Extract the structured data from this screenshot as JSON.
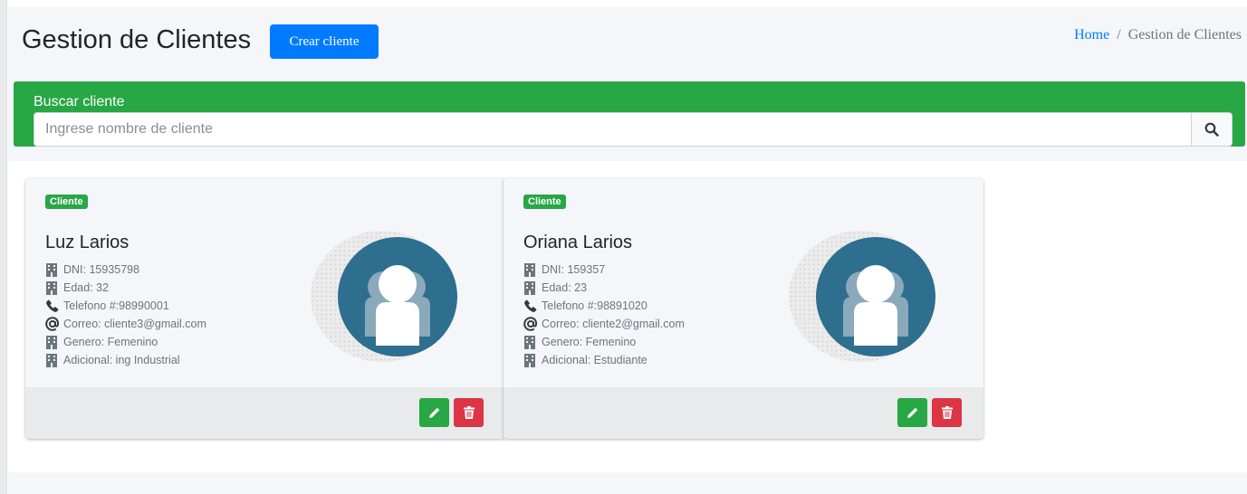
{
  "header": {
    "title": "Gestion de Clientes",
    "create_button": "Crear cliente",
    "breadcrumb": {
      "home": "Home",
      "separator": "/",
      "current": "Gestion de Clientes"
    }
  },
  "search": {
    "title": "Buscar cliente",
    "placeholder": "Ingrese nombre de cliente",
    "icon": "search-icon"
  },
  "clients": [
    {
      "badge": "Cliente",
      "name": "Luz Larios",
      "dni": "DNI: 15935798",
      "edad": "Edad: 32",
      "telefono": "Telefono #:98990001",
      "correo": "Correo: cliente3@gmail.com",
      "genero": "Genero: Femenino",
      "adicional": "Adicional: ing Industrial"
    },
    {
      "badge": "Cliente",
      "name": "Oriana Larios",
      "dni": "DNI: 159357",
      "edad": "Edad: 23",
      "telefono": "Telefono #:98891020",
      "correo": "Correo: cliente2@gmail.com",
      "genero": "Genero: Femenino",
      "adicional": "Adicional: Estudiante"
    }
  ],
  "colors": {
    "primary": "#007bff",
    "success": "#28a745",
    "danger": "#dc3545",
    "avatar_bg": "#2e6e8e",
    "background": "#f4f6f9"
  }
}
